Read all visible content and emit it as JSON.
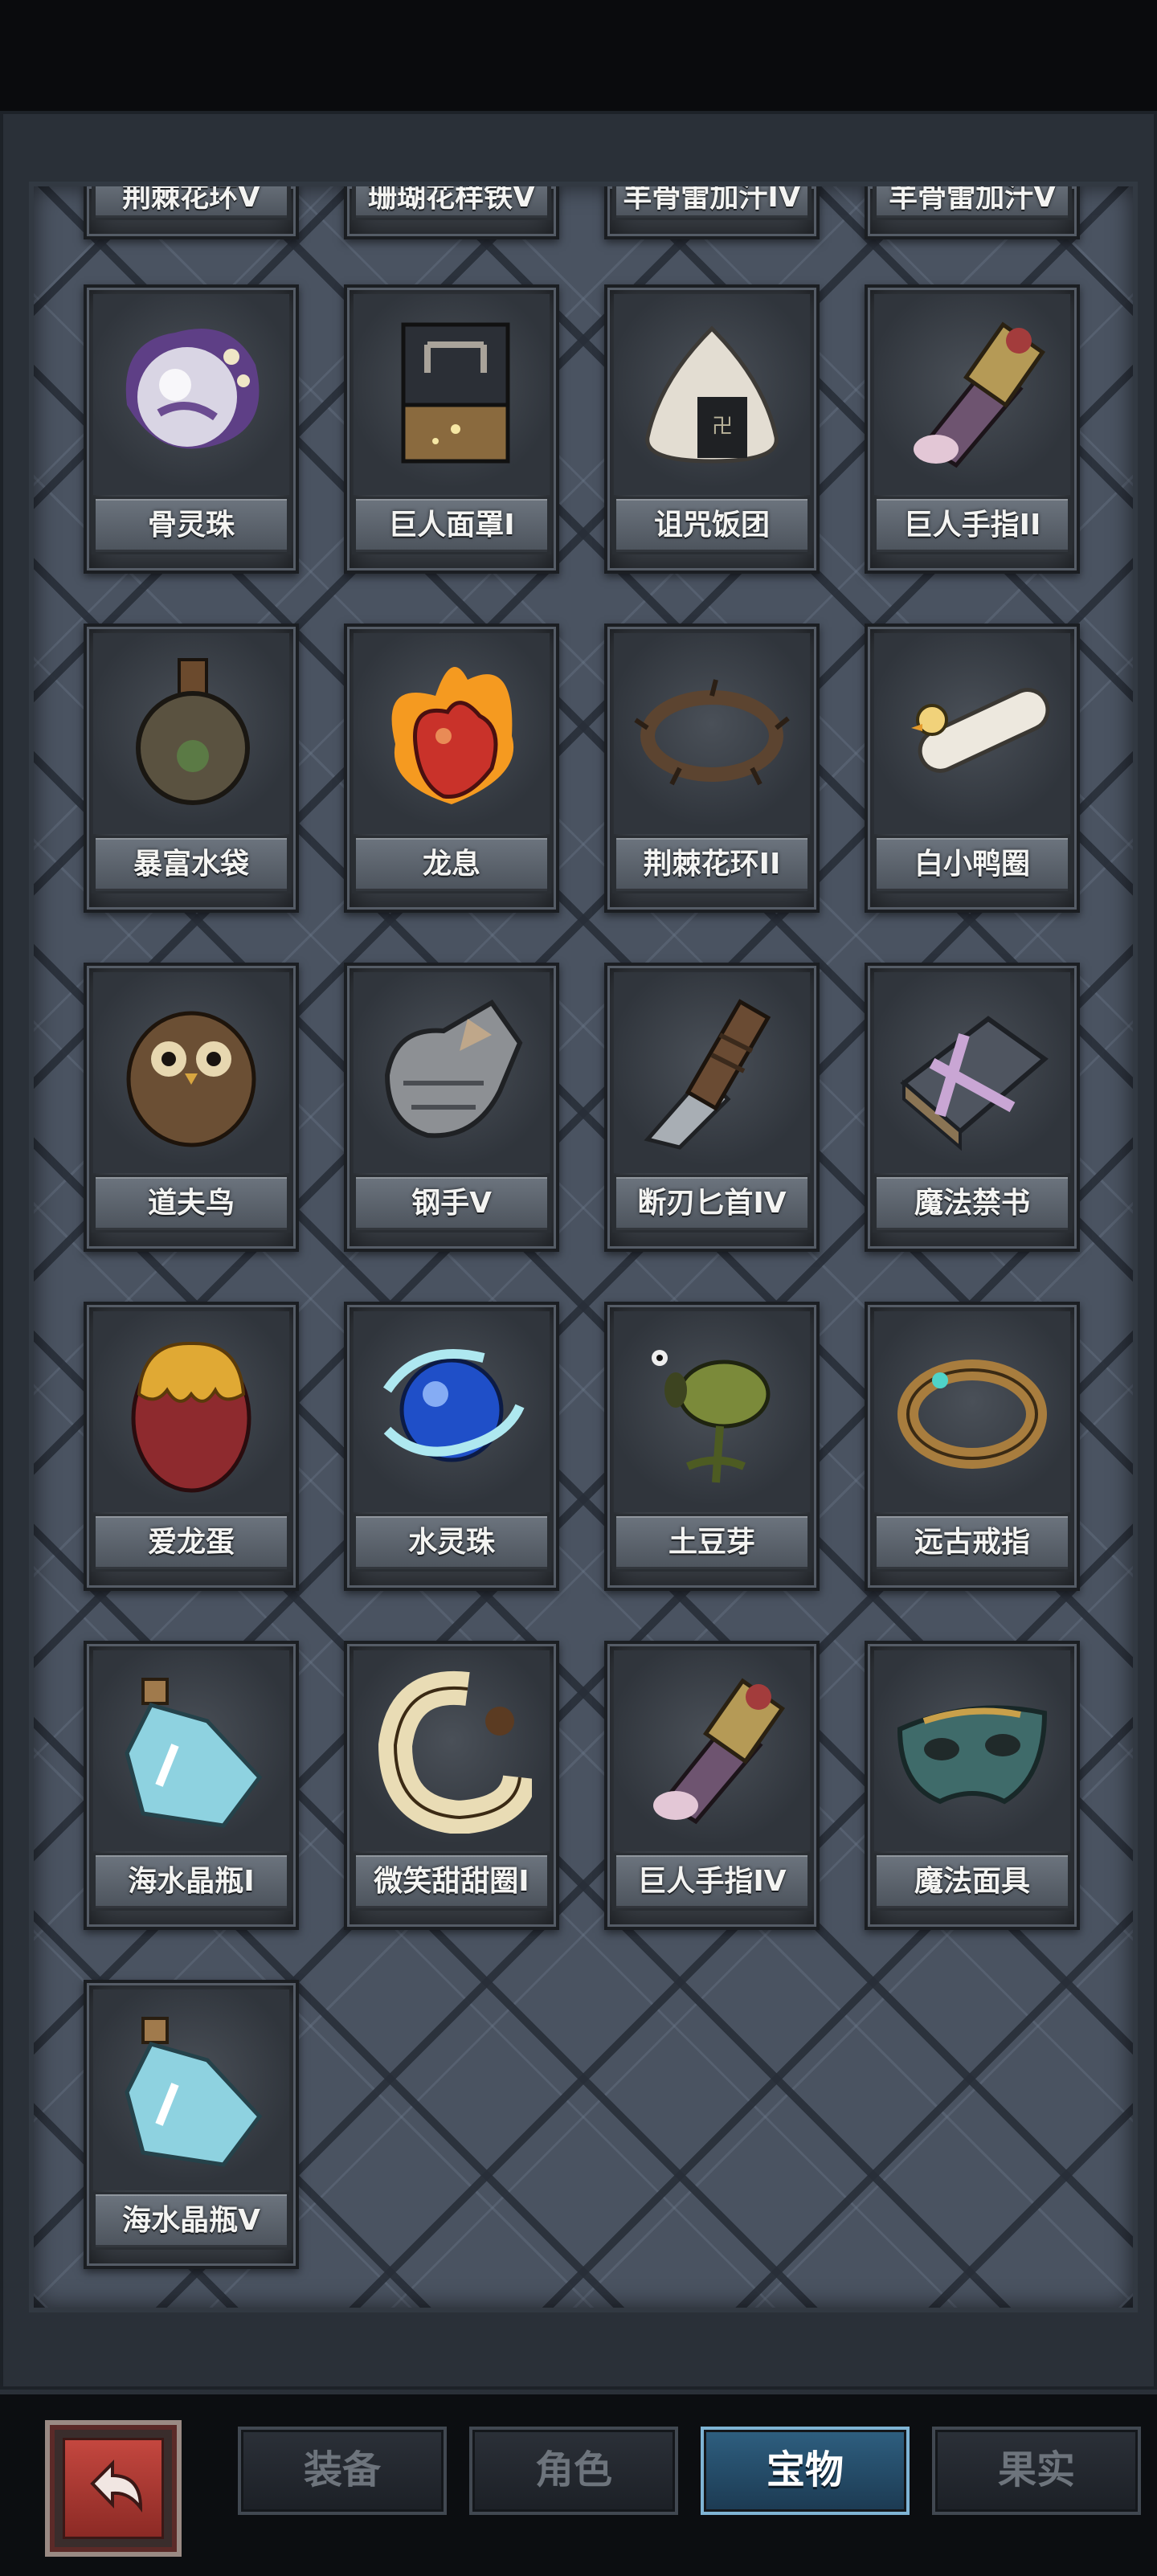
{
  "inventory": {
    "partial_row": [
      "荆棘花环V",
      "珊瑚花样铁V",
      "羊骨雷加汁IV",
      "羊骨雷加汁V"
    ],
    "items": [
      {
        "label": "骨灵珠",
        "icon": "bone-spirit-orb-icon"
      },
      {
        "label": "巨人面罩I",
        "icon": "giant-mask-icon"
      },
      {
        "label": "诅咒饭团",
        "icon": "cursed-rice-ball-icon"
      },
      {
        "label": "巨人手指II",
        "icon": "giant-finger-icon"
      },
      {
        "label": "暴富水袋",
        "icon": "water-pouch-icon"
      },
      {
        "label": "龙息",
        "icon": "dragon-breath-heart-icon"
      },
      {
        "label": "荆棘花环II",
        "icon": "thorn-wreath-icon"
      },
      {
        "label": "白小鸭圈",
        "icon": "duck-ring-icon"
      },
      {
        "label": "道夫鸟",
        "icon": "owl-bird-icon"
      },
      {
        "label": "钢手V",
        "icon": "steel-gauntlet-icon"
      },
      {
        "label": "断刃匕首IV",
        "icon": "broken-dagger-icon"
      },
      {
        "label": "魔法禁书",
        "icon": "forbidden-book-icon"
      },
      {
        "label": "爱龙蛋",
        "icon": "dragon-egg-icon"
      },
      {
        "label": "水灵珠",
        "icon": "water-spirit-orb-icon"
      },
      {
        "label": "土豆芽",
        "icon": "potato-sprout-icon"
      },
      {
        "label": "远古戒指",
        "icon": "ancient-ring-icon"
      },
      {
        "label": "海水晶瓶I",
        "icon": "crystal-bottle-icon"
      },
      {
        "label": "微笑甜甜圈I",
        "icon": "smile-donut-icon"
      },
      {
        "label": "巨人手指IV",
        "icon": "giant-finger-icon"
      },
      {
        "label": "魔法面具",
        "icon": "magic-mask-icon"
      },
      {
        "label": "海水晶瓶V",
        "icon": "crystal-bottle-icon"
      }
    ]
  },
  "tabs": [
    {
      "label": "装备",
      "active": false
    },
    {
      "label": "角色",
      "active": false
    },
    {
      "label": "宝物",
      "active": true
    },
    {
      "label": "果实",
      "active": false
    }
  ],
  "back_button": {
    "icon": "return-arrow-icon"
  },
  "colors": {
    "active_tab": "#2e5f80",
    "back_button": "#c4473f",
    "panel": "#4a5361"
  }
}
